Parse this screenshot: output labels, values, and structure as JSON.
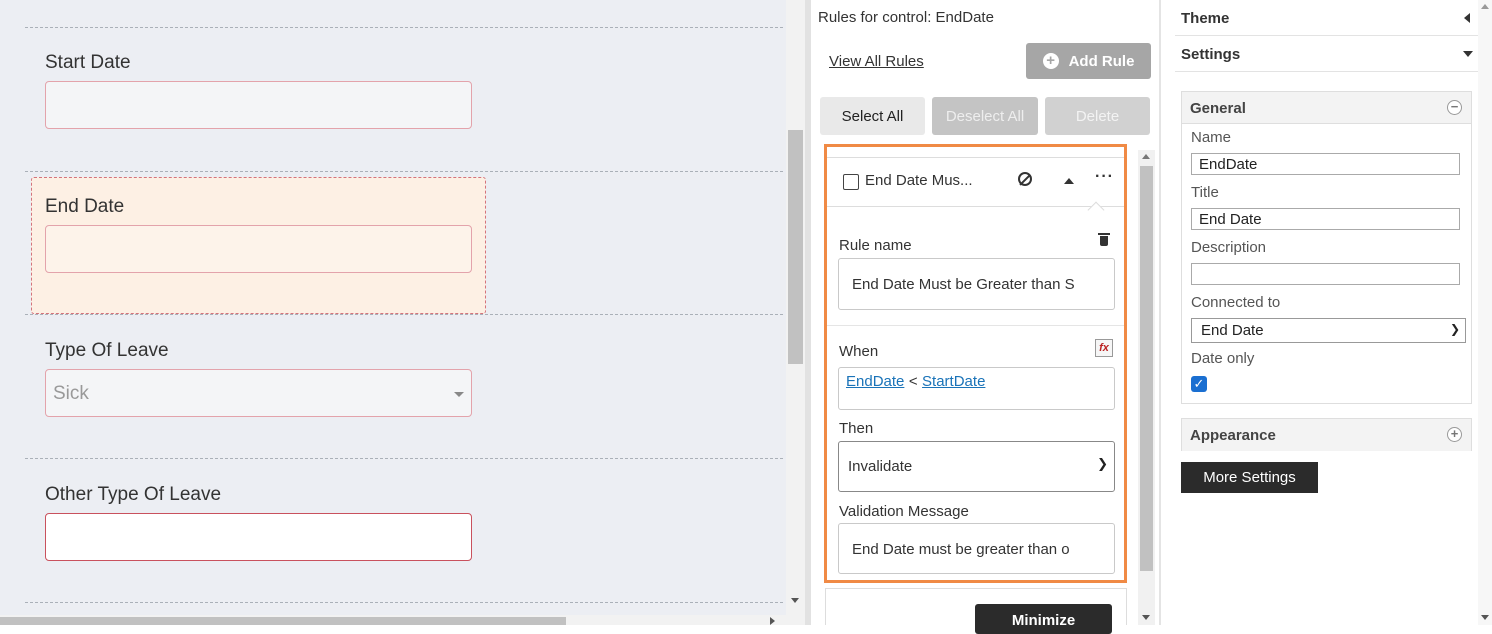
{
  "colors": {
    "canvas_bg": "#eceef3",
    "selected_bg": "#fdf0e4",
    "rule_highlight": "#f08a45",
    "link": "#1a73b8",
    "checkbox": "#1a6fd1",
    "dark_button": "#2b2b2b"
  },
  "canvas": {
    "fields": [
      {
        "label": "Start Date",
        "value": ""
      },
      {
        "label": "End Date",
        "value": ""
      },
      {
        "label": "Type Of Leave",
        "value": "Sick"
      },
      {
        "label": "Other Type Of Leave",
        "value": ""
      }
    ]
  },
  "rules": {
    "title": "Rules for control: EndDate",
    "view_all": "View All Rules",
    "add_rule": "Add Rule",
    "select_all": "Select All",
    "deselect_all": "Deselect All",
    "delete": "Delete",
    "rule": {
      "header_name": "End Date Mus...",
      "rule_name_label": "Rule name",
      "rule_name_value": "End Date Must be Greater than S",
      "when_label": "When",
      "when_left": "EndDate",
      "when_op": "<",
      "when_right": "StartDate",
      "then_label": "Then",
      "then_value": "Invalidate",
      "validation_label": "Validation Message",
      "validation_value": "End Date must be greater than o"
    },
    "minimize": "Minimize"
  },
  "props": {
    "theme": "Theme",
    "settings": "Settings",
    "general": "General",
    "name_label": "Name",
    "name_value": "EndDate",
    "title_label": "Title",
    "title_value": "End Date",
    "description_label": "Description",
    "description_value": "",
    "connected_label": "Connected to",
    "connected_value": "End Date",
    "date_only_label": "Date only",
    "date_only_checked": true,
    "appearance": "Appearance",
    "more_settings": "More Settings"
  }
}
